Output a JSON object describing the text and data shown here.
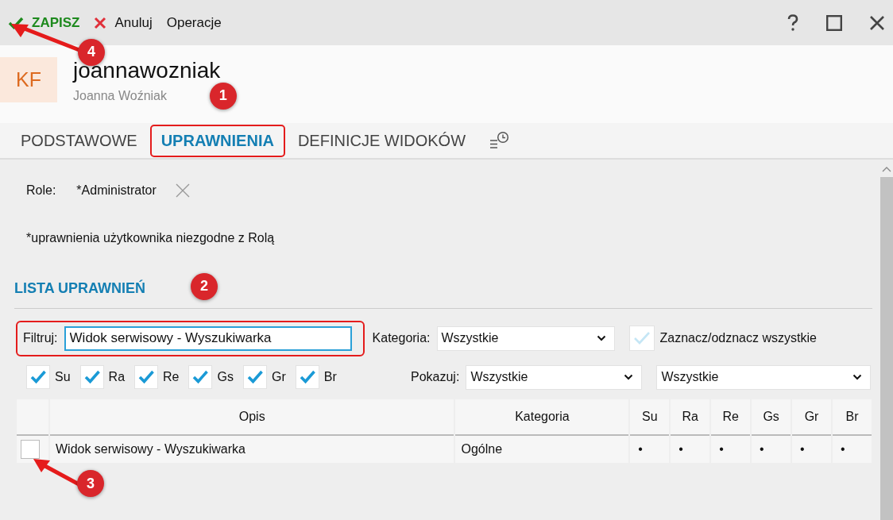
{
  "toolbar": {
    "save": {
      "label": "ZAPISZ",
      "annotation": "4"
    },
    "cancel": "Anuluj",
    "operations": "Operacje"
  },
  "user": {
    "avatar": "KF",
    "login": "joannawozniak",
    "full_name": "Joanna Woźniak"
  },
  "tabs": [
    {
      "label": "PODSTAWOWE",
      "selected": false
    },
    {
      "label": "UPRAWNIENIA",
      "selected": true,
      "annotation": "1"
    },
    {
      "label": "DEFINICJE WIDOKÓW",
      "selected": false
    }
  ],
  "roles": {
    "label": "Role:",
    "value": "*Administrator"
  },
  "note": "*uprawnienia użytkownika niezgodne z Rolą",
  "section_title": "LISTA UPRAWNIEŃ",
  "filter": {
    "label": "Filtruj:",
    "value": "Widok serwisowy - Wyszukiwarka",
    "annotation": "2"
  },
  "category": {
    "label": "Kategoria:",
    "value": "Wszystkie"
  },
  "select_all": {
    "label": "Zaznacz/odznacz wszystkie",
    "checked": false
  },
  "flags": [
    {
      "label": "Su",
      "checked": true
    },
    {
      "label": "Ra",
      "checked": true
    },
    {
      "label": "Re",
      "checked": true
    },
    {
      "label": "Gs",
      "checked": true
    },
    {
      "label": "Gr",
      "checked": true
    },
    {
      "label": "Br",
      "checked": true
    }
  ],
  "show": {
    "label": "Pokazuj:",
    "value": "Wszystkie",
    "value_2": "Wszystkie"
  },
  "table": {
    "columns": [
      "Opis",
      "Kategoria",
      "Su",
      "Ra",
      "Re",
      "Gs",
      "Gr",
      "Br"
    ],
    "rows": [
      {
        "checked": false,
        "annotation": "3",
        "cells": [
          "Widok serwisowy - Wyszukiwarka",
          "Ogólne",
          "•",
          "•",
          "•",
          "•",
          "•",
          "•"
        ]
      }
    ]
  }
}
